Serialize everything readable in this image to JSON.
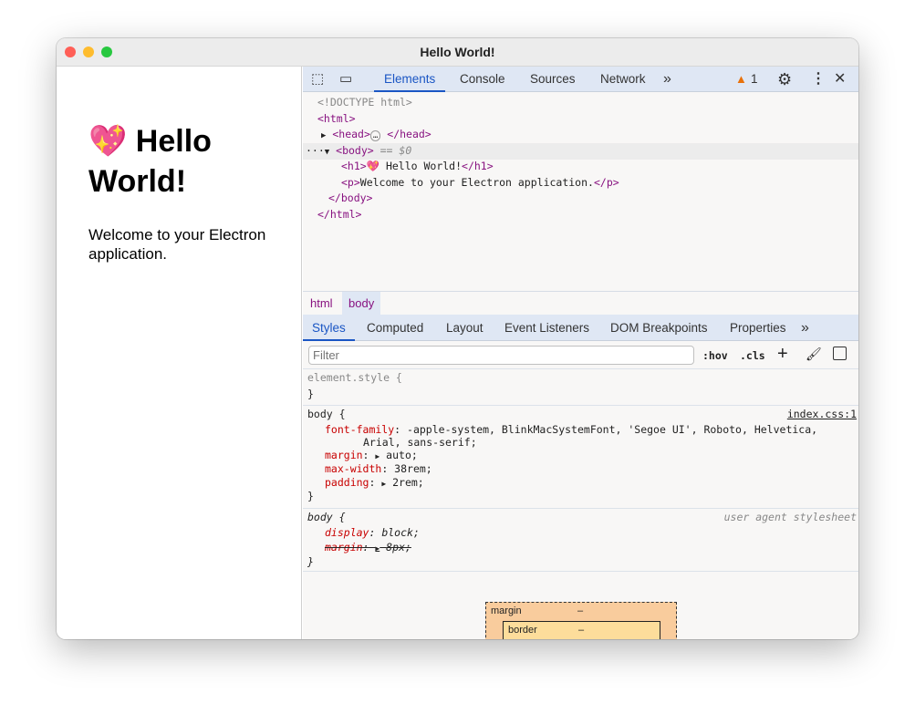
{
  "window": {
    "title": "Hello World!",
    "colors": {
      "close": "#ff5f57",
      "minimize": "#febc2e",
      "zoom": "#28c840"
    }
  },
  "page": {
    "emoji": "💖",
    "heading": "Hello World!",
    "paragraph": "Welcome to your Electron application."
  },
  "devtools": {
    "tabs": [
      "Elements",
      "Console",
      "Sources",
      "Network"
    ],
    "more": "»",
    "warning_count": "1",
    "tree": {
      "doctype": "<!DOCTYPE html>",
      "html_open": "<html>",
      "head_open": "<head>",
      "head_ellipsis": "…",
      "head_close": "</head>",
      "body_open": "<body>",
      "body_selected": "== $0",
      "h1_open": "<h1>",
      "h1_text": "💖 Hello World!",
      "h1_close": "</h1>",
      "p_open": "<p>",
      "p_text": "Welcome to your Electron application.",
      "p_close": "</p>",
      "body_close": "</body>",
      "html_close": "</html>",
      "row_menu": "···"
    },
    "breadcrumbs": [
      "html",
      "body"
    ],
    "styles_tabs": [
      "Styles",
      "Computed",
      "Layout",
      "Event Listeners",
      "DOM Breakpoints",
      "Properties"
    ],
    "filter_placeholder": "Filter",
    "hov": ":hov",
    "cls": ".cls",
    "rules": {
      "element_style": "element.style {",
      "close": "}",
      "body_selector": "body {",
      "body_source": "index.css:1",
      "font_family_name": "font-family",
      "font_family_value": "-apple-system, BlinkMacSystemFont, 'Segoe UI', Roboto, Helvetica,",
      "font_family_value2": "Arial, sans-serif;",
      "margin_name": "margin",
      "margin_value": "auto;",
      "max_width_name": "max-width",
      "max_width_value": "38rem;",
      "padding_name": "padding",
      "padding_value": "2rem;",
      "ua_selector": "body {",
      "ua_source": "user agent stylesheet",
      "display_name": "display",
      "display_value": "block;",
      "ua_margin_name": "margin",
      "ua_margin_value": "8px;"
    },
    "box_model": {
      "margin_label": "margin",
      "margin_value": "–",
      "border_label": "border",
      "border_value": "–"
    }
  }
}
